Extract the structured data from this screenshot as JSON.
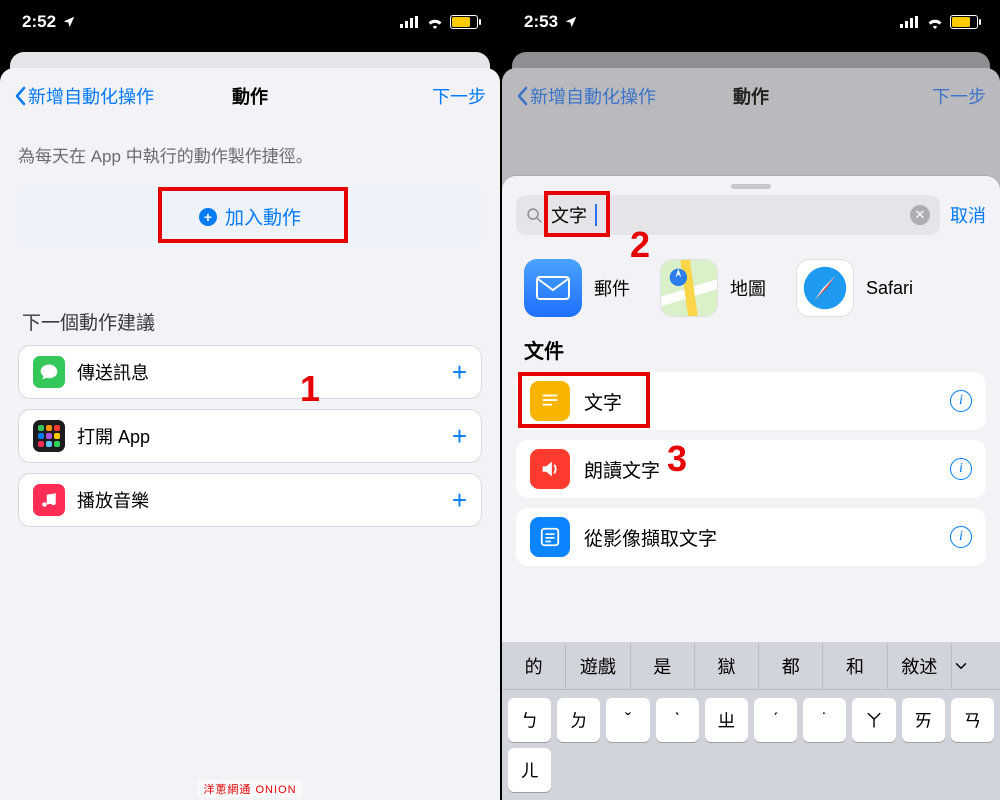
{
  "left": {
    "status_time": "2:52",
    "nav_back": "新增自動化操作",
    "nav_title": "動作",
    "nav_next": "下一步",
    "hint": "為每天在 App 中執行的動作製作捷徑。",
    "add_action": "加入動作",
    "annot1": "1",
    "section_title": "下一個動作建議",
    "suggestions": [
      {
        "label": "傳送訊息"
      },
      {
        "label": "打開 App"
      },
      {
        "label": "播放音樂"
      }
    ]
  },
  "right": {
    "status_time": "2:53",
    "nav_back": "新增自動化操作",
    "nav_title": "動作",
    "nav_next": "下一步",
    "search_query": "文字",
    "cancel": "取消",
    "annot2": "2",
    "annot3": "3",
    "apps": [
      {
        "name": "郵件"
      },
      {
        "name": "地圖"
      },
      {
        "name": "Safari"
      }
    ],
    "category": "文件",
    "results": [
      {
        "label": "文字"
      },
      {
        "label": "朗讀文字"
      },
      {
        "label": "從影像擷取文字"
      }
    ],
    "kb_suggestions": [
      "的",
      "遊戲",
      "是",
      "獄",
      "都",
      "和",
      "敘述"
    ],
    "kb_row1": [
      "ㄅ",
      "ㄉ",
      "ˇ",
      "ˋ",
      "ㄓ",
      "ˊ",
      "˙",
      "ㄚ",
      "ㄞ",
      "ㄢ"
    ]
  },
  "watermark": "洋蔥網通 ONION"
}
